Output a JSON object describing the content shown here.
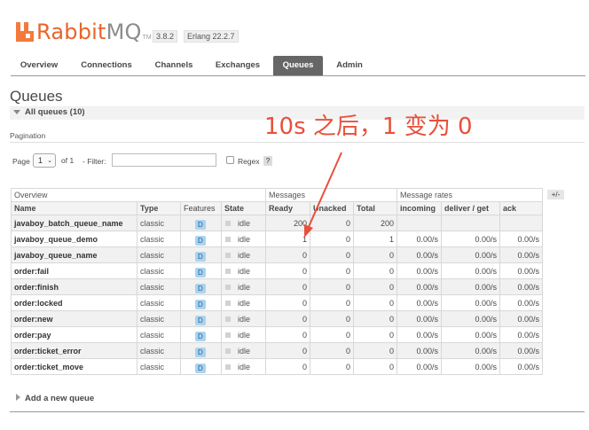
{
  "header": {
    "logo_rabbit": "Rabbit",
    "logo_mq": "MQ",
    "logo_tm": "TM",
    "version": "3.8.2",
    "erlang": "Erlang 22.2.7"
  },
  "tabs": [
    {
      "label": "Overview",
      "active": false
    },
    {
      "label": "Connections",
      "active": false
    },
    {
      "label": "Channels",
      "active": false
    },
    {
      "label": "Exchanges",
      "active": false
    },
    {
      "label": "Queues",
      "active": true
    },
    {
      "label": "Admin",
      "active": false
    }
  ],
  "page": {
    "title": "Queues",
    "section": "All queues (10)",
    "pagination_label": "Pagination"
  },
  "pagination": {
    "page_label": "Page",
    "page_value": "1",
    "of_label": "of 1",
    "filter_label": "- Filter:",
    "filter_value": "",
    "regex_label": "Regex",
    "help": "?"
  },
  "table": {
    "group_headers": {
      "overview": "Overview",
      "messages": "Messages",
      "rates": "Message rates"
    },
    "plus_minus": "+/-",
    "columns": [
      "Name",
      "Type",
      "Features",
      "State",
      "Ready",
      "Unacked",
      "Total",
      "incoming",
      "deliver / get",
      "ack"
    ],
    "rows": [
      {
        "name": "javaboy_batch_queue_name",
        "type": "classic",
        "feature": "D",
        "state": "idle",
        "ready": "200",
        "unacked": "0",
        "total": "200",
        "incoming": "",
        "deliver": "",
        "ack": ""
      },
      {
        "name": "javaboy_queue_demo",
        "type": "classic",
        "feature": "D",
        "state": "idle",
        "ready": "1",
        "unacked": "0",
        "total": "1",
        "incoming": "0.00/s",
        "deliver": "0.00/s",
        "ack": "0.00/s"
      },
      {
        "name": "javaboy_queue_name",
        "type": "classic",
        "feature": "D",
        "state": "idle",
        "ready": "0",
        "unacked": "0",
        "total": "0",
        "incoming": "0.00/s",
        "deliver": "0.00/s",
        "ack": "0.00/s"
      },
      {
        "name": "order:fail",
        "type": "classic",
        "feature": "D",
        "state": "idle",
        "ready": "0",
        "unacked": "0",
        "total": "0",
        "incoming": "0.00/s",
        "deliver": "0.00/s",
        "ack": "0.00/s"
      },
      {
        "name": "order:finish",
        "type": "classic",
        "feature": "D",
        "state": "idle",
        "ready": "0",
        "unacked": "0",
        "total": "0",
        "incoming": "0.00/s",
        "deliver": "0.00/s",
        "ack": "0.00/s"
      },
      {
        "name": "order:locked",
        "type": "classic",
        "feature": "D",
        "state": "idle",
        "ready": "0",
        "unacked": "0",
        "total": "0",
        "incoming": "0.00/s",
        "deliver": "0.00/s",
        "ack": "0.00/s"
      },
      {
        "name": "order:new",
        "type": "classic",
        "feature": "D",
        "state": "idle",
        "ready": "0",
        "unacked": "0",
        "total": "0",
        "incoming": "0.00/s",
        "deliver": "0.00/s",
        "ack": "0.00/s"
      },
      {
        "name": "order:pay",
        "type": "classic",
        "feature": "D",
        "state": "idle",
        "ready": "0",
        "unacked": "0",
        "total": "0",
        "incoming": "0.00/s",
        "deliver": "0.00/s",
        "ack": "0.00/s"
      },
      {
        "name": "order:ticket_error",
        "type": "classic",
        "feature": "D",
        "state": "idle",
        "ready": "0",
        "unacked": "0",
        "total": "0",
        "incoming": "0.00/s",
        "deliver": "0.00/s",
        "ack": "0.00/s"
      },
      {
        "name": "order:ticket_move",
        "type": "classic",
        "feature": "D",
        "state": "idle",
        "ready": "0",
        "unacked": "0",
        "total": "0",
        "incoming": "0.00/s",
        "deliver": "0.00/s",
        "ack": "0.00/s"
      }
    ]
  },
  "add_queue": "Add a new queue",
  "annotation": {
    "text": "10s 之后，1 变为 0",
    "color": "#e8503a"
  },
  "colors": {
    "brand_orange": "#f47a3b",
    "active_tab": "#666666",
    "feature_badge": "#a9d4f2"
  }
}
